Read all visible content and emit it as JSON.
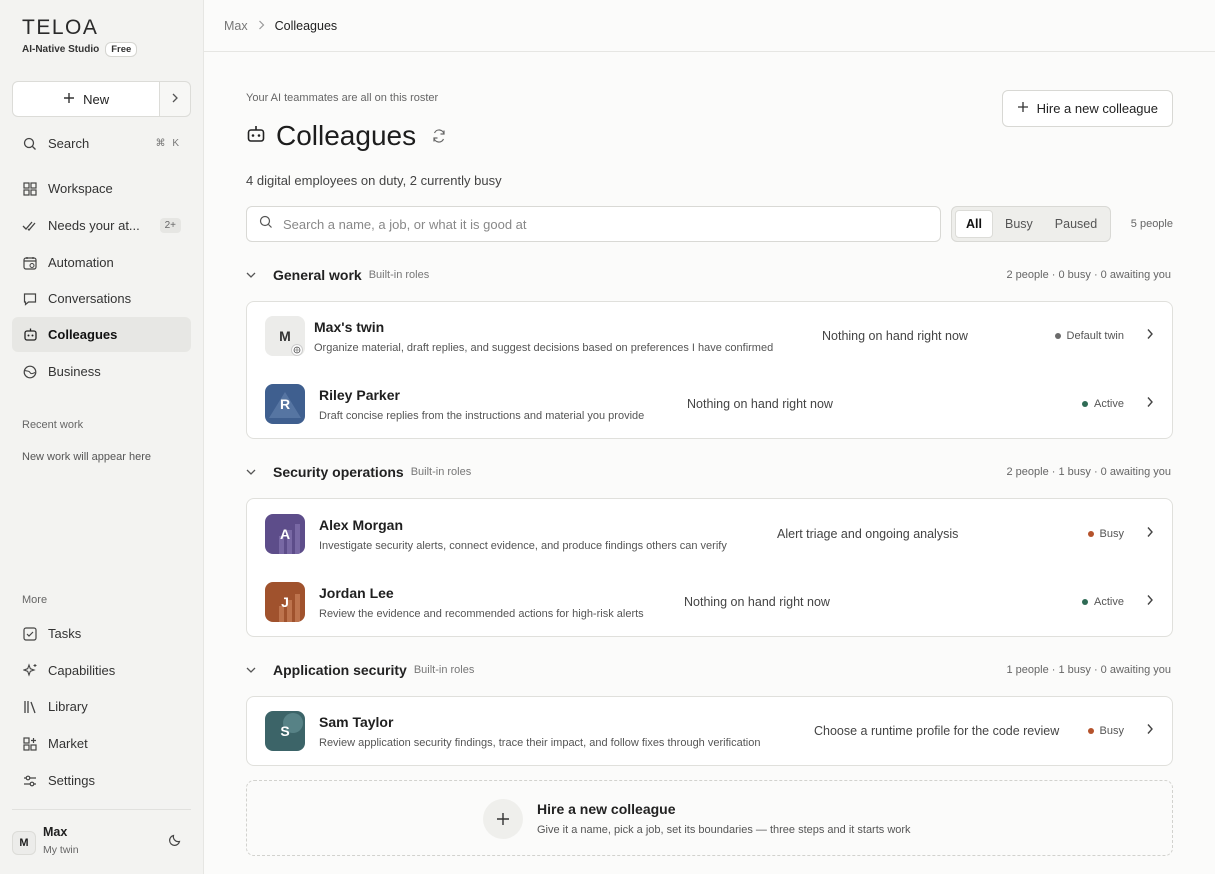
{
  "brand": {
    "logo": "TELOA",
    "tagline": "AI-Native Studio",
    "plan": "Free"
  },
  "sidebar": {
    "new_label": "New",
    "items": [
      {
        "label": "Search",
        "shortcut": "⌘ K"
      },
      {
        "label": "Workspace"
      },
      {
        "label": "Needs your at...",
        "count": "2+"
      },
      {
        "label": "Automation"
      },
      {
        "label": "Conversations"
      },
      {
        "label": "Colleagues"
      },
      {
        "label": "Business"
      }
    ],
    "recent_label": "Recent work",
    "recent_empty": "New work will appear here",
    "more_label": "More",
    "more_items": [
      {
        "label": "Tasks"
      },
      {
        "label": "Capabilities"
      },
      {
        "label": "Library"
      },
      {
        "label": "Market"
      },
      {
        "label": "Settings"
      }
    ],
    "user": {
      "initial": "M",
      "name": "Max",
      "sub": "My twin"
    }
  },
  "breadcrumb": {
    "parent": "Max",
    "current": "Colleagues"
  },
  "header": {
    "eyebrow": "Your AI teammates are all on this roster",
    "title": "Colleagues",
    "subtitle": "4 digital employees on duty, 2 currently busy",
    "hire_button": "Hire a new colleague"
  },
  "filters": {
    "search_placeholder": "Search a name, a job, or what it is good at",
    "tabs": [
      "All",
      "Busy",
      "Paused"
    ],
    "selected": "All",
    "count": "5 people"
  },
  "status_colors": {
    "default": "#6b6b6b",
    "active": "#2f6b55",
    "busy": "#b5532c"
  },
  "groups": [
    {
      "name": "General work",
      "tag": "Built-in roles",
      "stats": "2 people · 0 busy · 0 awaiting you",
      "people": [
        {
          "initial": "M",
          "name": "Max's twin",
          "desc": "Organize material, draft replies, and suggest decisions based on preferences I have confirmed",
          "task": "Nothing on hand right now",
          "status": "Default twin",
          "status_kind": "default",
          "avatar_color": "#ececea"
        },
        {
          "initial": "R",
          "name": "Riley Parker",
          "desc": "Draft concise replies from the instructions and material you provide",
          "task": "Nothing on hand right now",
          "status": "Active",
          "status_kind": "active",
          "avatar_color": "#3f5f8f"
        }
      ]
    },
    {
      "name": "Security operations",
      "tag": "Built-in roles",
      "stats": "2 people · 1 busy · 0 awaiting you",
      "people": [
        {
          "initial": "A",
          "name": "Alex Morgan",
          "desc": "Investigate security alerts, connect evidence, and produce findings others can verify",
          "task": "Alert triage and ongoing analysis",
          "status": "Busy",
          "status_kind": "busy",
          "avatar_color": "#5d4d8a"
        },
        {
          "initial": "J",
          "name": "Jordan Lee",
          "desc": "Review the evidence and recommended actions for high-risk alerts",
          "task": "Nothing on hand right now",
          "status": "Active",
          "status_kind": "active",
          "avatar_color": "#a0522d"
        }
      ]
    },
    {
      "name": "Application security",
      "tag": "Built-in roles",
      "stats": "1 people · 1 busy · 0 awaiting you",
      "people": [
        {
          "initial": "S",
          "name": "Sam Taylor",
          "desc": "Review application security findings, trace their impact, and follow fixes through verification",
          "task": "Choose a runtime profile for the code review",
          "status": "Busy",
          "status_kind": "busy",
          "avatar_color": "#3c6468"
        }
      ]
    }
  ],
  "hire_card": {
    "title": "Hire a new colleague",
    "desc": "Give it a name, pick a job, set its boundaries — three steps and it starts work"
  }
}
